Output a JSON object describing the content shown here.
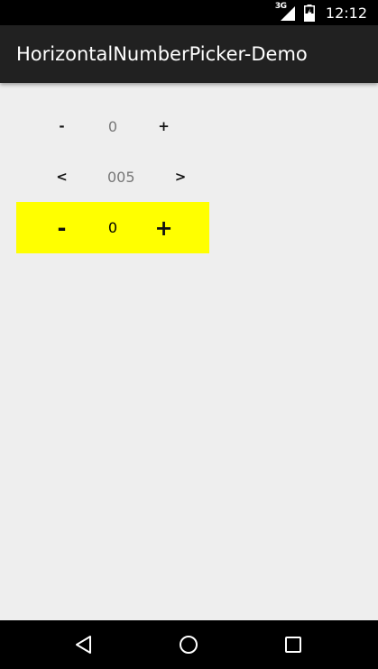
{
  "status_bar": {
    "network_type": "3G",
    "time": "12:12",
    "icons": [
      "signal-icon",
      "battery-charging-icon"
    ]
  },
  "app_bar": {
    "title": "HorizontalNumberPicker-Demo"
  },
  "pickers": [
    {
      "minus_label": "-",
      "value": "0",
      "plus_label": "+"
    },
    {
      "minus_label": "<",
      "value": "005",
      "plus_label": ">"
    },
    {
      "minus_label": "-",
      "value": "0",
      "plus_label": "+",
      "background": "#ffff00"
    }
  ],
  "nav_bar": {
    "icons": [
      "back-icon",
      "home-icon",
      "recents-icon"
    ]
  },
  "colors": {
    "status_bar": "#000000",
    "app_bar": "#212121",
    "background": "#eeeeee",
    "highlight_picker": "#ffff00"
  }
}
